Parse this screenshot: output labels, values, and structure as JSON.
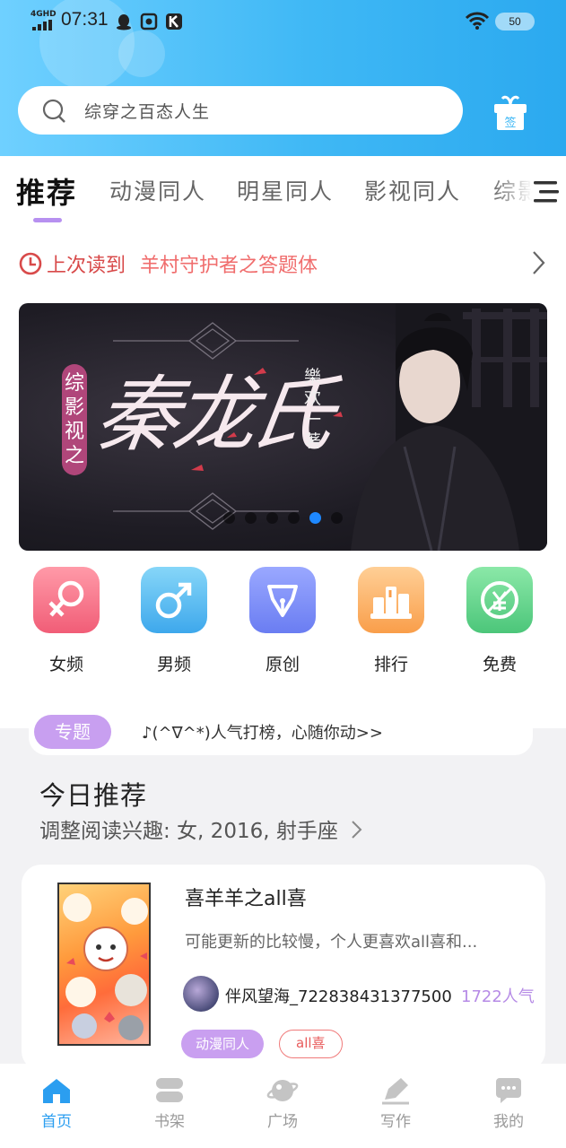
{
  "status_bar": {
    "network": "4GHD",
    "time": "07:31",
    "battery": "50"
  },
  "search": {
    "text": "综穿之百态人生"
  },
  "gift_icon_label": "签",
  "tabs": [
    {
      "label": "推荐"
    },
    {
      "label": "动漫同人"
    },
    {
      "label": "明星同人"
    },
    {
      "label": "影视同人"
    },
    {
      "label": "综影"
    }
  ],
  "last_read": {
    "prefix": "上次读到",
    "title": "羊村守护者之答题体"
  },
  "banner": {
    "vertical_title": "综影视之",
    "title": "秦龙氏",
    "author": "樂欢一著",
    "dots_total": 6,
    "active_dot": 4
  },
  "categories": [
    {
      "label": "女频",
      "color_top": "#ff8fa0",
      "color_bottom": "#f2607a",
      "icon": "female-icon"
    },
    {
      "label": "男频",
      "color_top": "#7ad0f7",
      "color_bottom": "#3ea8ec",
      "icon": "male-icon"
    },
    {
      "label": "原创",
      "color_top": "#8fa0ff",
      "color_bottom": "#6a7df2",
      "icon": "pen-nib-icon"
    },
    {
      "label": "排行",
      "color_top": "#ffc88a",
      "color_bottom": "#f99e4a",
      "icon": "ranking-icon"
    },
    {
      "label": "免费",
      "color_top": "#86e6a2",
      "color_bottom": "#4cc67a",
      "icon": "yen-free-icon"
    }
  ],
  "topic": {
    "pill": "专题",
    "text": "♪(^∇^*)人气打榜，心随你动>>"
  },
  "recommend": {
    "title": "今日推荐",
    "subtitle": "调整阅读兴趣: 女, 2016, 射手座"
  },
  "book": {
    "title": "喜羊羊之all喜",
    "description": "可能更新的比较慢，个人更喜欢all喜和...",
    "author": "伴风望海_722838431377500",
    "popularity": "1722人气",
    "tags": [
      "动漫同人",
      "all喜"
    ]
  },
  "bottom_nav": [
    {
      "label": "首页",
      "active": true
    },
    {
      "label": "书架",
      "active": false
    },
    {
      "label": "广场",
      "active": false
    },
    {
      "label": "写作",
      "active": false
    },
    {
      "label": "我的",
      "active": false
    }
  ]
}
